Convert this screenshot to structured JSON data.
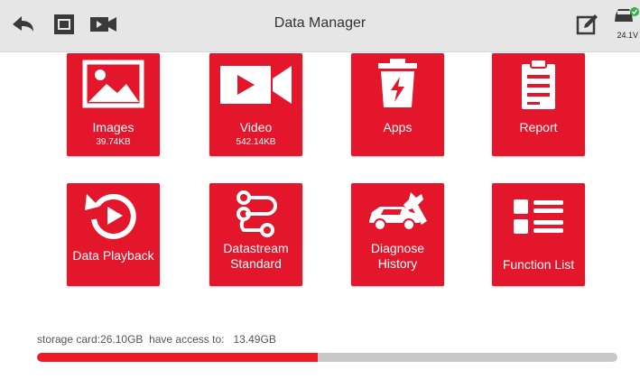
{
  "header": {
    "title": "Data Manager",
    "icons": [
      "back-arrow-icon",
      "window-icon",
      "video-camera-icon",
      "edit-icon",
      "car-battery-icon"
    ],
    "battery_voltage": "24.1V"
  },
  "tiles": [
    {
      "label": "Images",
      "sub": "39.74KB",
      "icon": "image-icon"
    },
    {
      "label": "Video",
      "sub": "542.14KB",
      "icon": "video-icon"
    },
    {
      "label": "Apps",
      "sub": "",
      "icon": "trash-apps-icon"
    },
    {
      "label": "Report",
      "sub": "",
      "icon": "clipboard-icon"
    },
    {
      "label": "Data Playback",
      "sub": "",
      "icon": "playback-icon"
    },
    {
      "label": "Datastream Standard",
      "label_line1": "Datastream",
      "label_line2": "Standard",
      "icon": "datastream-icon"
    },
    {
      "label": "Diagnose History",
      "label_line1": "Diagnose",
      "label_line2": "History",
      "icon": "car-wrench-icon"
    },
    {
      "label": "Function List",
      "sub": "",
      "icon": "list-icon"
    }
  ],
  "storage": {
    "text": "storage card:26.10GB  have access to:   13.49GB",
    "used_fraction": 0.483
  },
  "colors": {
    "tile": "#e3162b",
    "topbar": "#e6e6e6",
    "bar_fill": "#ed1c24",
    "bar_track": "#c8c8c8"
  }
}
